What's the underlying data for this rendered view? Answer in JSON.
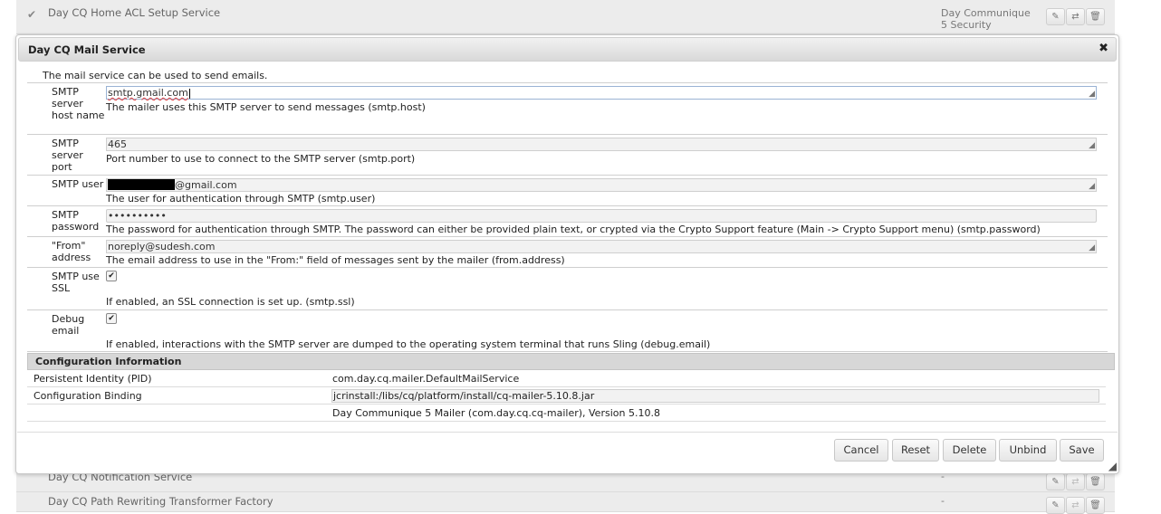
{
  "background": {
    "top_row": {
      "name": "Day CQ Home ACL Setup Service",
      "location_line1": "Day Communique",
      "location_line2": "5 Security"
    },
    "rows": [
      {
        "name": "Day CQ Notification Service",
        "location": "-"
      },
      {
        "name": "Day CQ Path Rewriting Transformer Factory",
        "location": "-"
      }
    ]
  },
  "dialog": {
    "title": "Day CQ Mail Service",
    "close_glyph": "✖",
    "description": "The mail service can be used to send emails.",
    "properties": {
      "smtp_host": {
        "label": "SMTP server host name",
        "value": "smtp.gmail.com",
        "help": "The mailer uses this SMTP server to send messages (smtp.host)"
      },
      "smtp_port": {
        "label": "SMTP server port",
        "value": "465",
        "help": "Port number to use to connect to the SMTP server (smtp.port)"
      },
      "smtp_user": {
        "label": "SMTP user",
        "value_suffix": "@gmail.com",
        "help": "The user for authentication through SMTP (smtp.user)"
      },
      "smtp_password": {
        "label": "SMTP password",
        "value": "••••••••••",
        "help": "The password for authentication through SMTP. The password can either be provided plain text, or crypted via the Crypto Support feature (Main -> Crypto Support menu) (smtp.password)"
      },
      "from_address": {
        "label": "\"From\" address",
        "value": "noreply@sudesh.com",
        "help": "The email address to use in the \"From:\" field of messages sent by the mailer (from.address)"
      },
      "smtp_ssl": {
        "label": "SMTP use SSL",
        "checked": true,
        "help": "If enabled, an SSL connection is set up. (smtp.ssl)"
      },
      "debug_email": {
        "label": "Debug email",
        "checked": true,
        "help": "If enabled, interactions with the SMTP server are dumped to the operating system terminal that runs Sling (debug.email)"
      }
    },
    "config_info": {
      "header": "Configuration Information",
      "pid_label": "Persistent Identity (PID)",
      "pid_value": "com.day.cq.mailer.DefaultMailService",
      "binding_label": "Configuration Binding",
      "binding_value": "jcrinstall:/libs/cq/platform/install/cq-mailer-5.10.8.jar",
      "bundle_value": "Day Communique 5 Mailer (com.day.cq.cq-mailer), Version 5.10.8"
    },
    "buttons": {
      "cancel": "Cancel",
      "reset": "Reset",
      "delete": "Delete",
      "unbind": "Unbind",
      "save": "Save"
    }
  }
}
